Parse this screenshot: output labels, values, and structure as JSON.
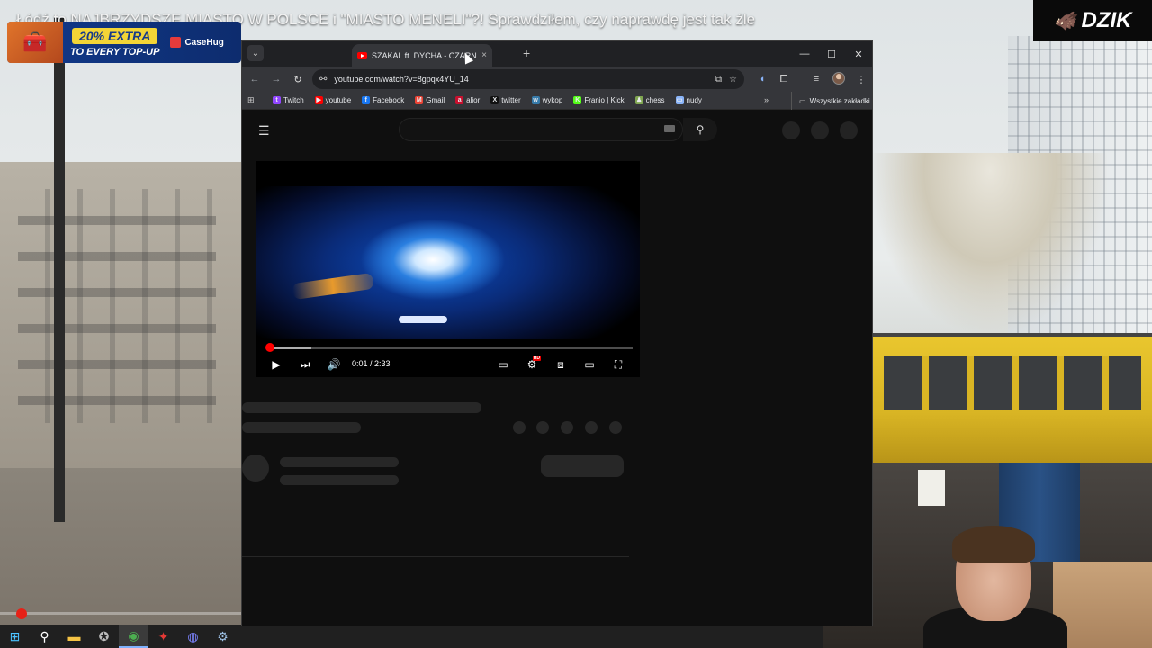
{
  "stream": {
    "title": "Łódź to NAJBRZYDSZE MIASTO W POLSCE i \"MIASTO MENELI\"?! Sprawdziłem, czy naprawdę jest tak źle",
    "logo": "DZIK",
    "scrub_progress": 0.09
  },
  "sponsor": {
    "extra": "20% EXTRA",
    "sub": "TO EVERY TOP-UP",
    "brand": "CaseHug"
  },
  "browser": {
    "tab_title": "SZAKAL ft. DYCHA - CZARN",
    "tab_close": "×",
    "new_tab": "+",
    "url": "youtube.com/watch?v=8gpqx4YU_14",
    "bookmarks": [
      {
        "label": "Twitch",
        "color": "#9146ff",
        "glyph": "t"
      },
      {
        "label": "youtube",
        "color": "#ff0000",
        "glyph": "▶"
      },
      {
        "label": "Facebook",
        "color": "#1877f2",
        "glyph": "f"
      },
      {
        "label": "Gmail",
        "color": "#ea4335",
        "glyph": "M"
      },
      {
        "label": "alior",
        "color": "#c8102e",
        "glyph": "a"
      },
      {
        "label": "twitter",
        "color": "#111111",
        "glyph": "X"
      },
      {
        "label": "wykop",
        "color": "#367aa9",
        "glyph": "w"
      },
      {
        "label": "Franio | Kick",
        "color": "#53fc18",
        "glyph": "K"
      },
      {
        "label": "chess",
        "color": "#7fa650",
        "glyph": "♟"
      },
      {
        "label": "nudy",
        "color": "#8ab4f8",
        "glyph": "▭"
      }
    ],
    "all_bookmarks": "Wszystkie zakładki"
  },
  "player": {
    "time": "0:01 / 2:33",
    "played_fraction": 0.007,
    "loaded_fraction": 0.12,
    "hd_badge": "HD"
  },
  "icons": {
    "menu": "hamburger-icon",
    "search": "search-icon",
    "play": "play-icon",
    "next": "next-icon",
    "volume": "volume-icon",
    "subtitles": "subtitles-icon",
    "settings": "settings-icon",
    "miniplayer": "miniplayer-icon",
    "theater": "theater-icon",
    "fullscreen": "fullscreen-icon"
  },
  "colors": {
    "yt_red": "#ff0000",
    "chrome_dark": "#35363a"
  }
}
